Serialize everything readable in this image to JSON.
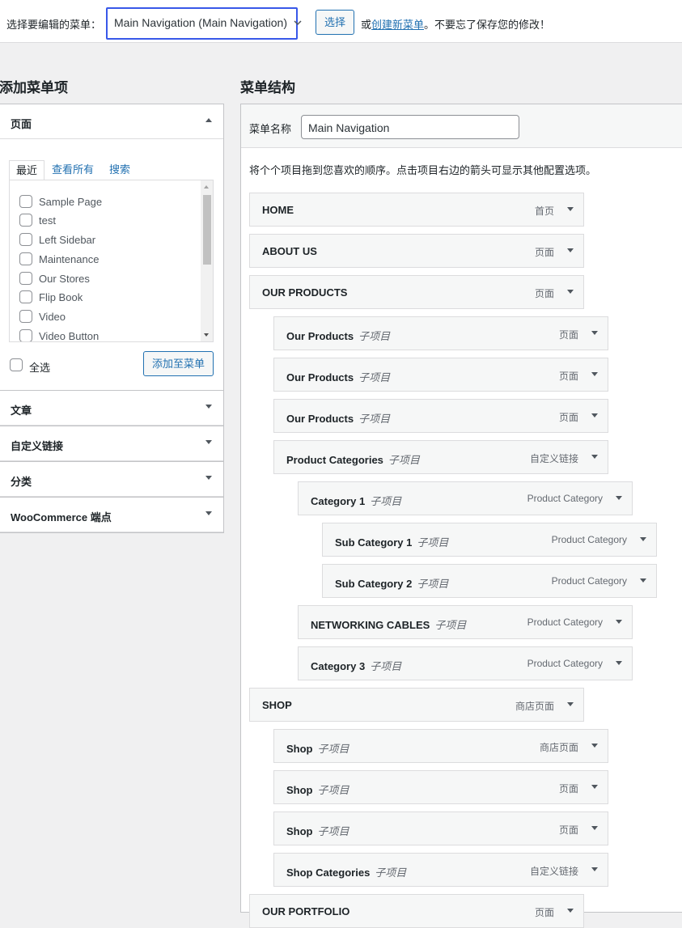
{
  "top_bar": {
    "select_label": "选择要编辑的菜单：",
    "selected_menu": "Main Navigation (Main Navigation)",
    "select_button": "选择",
    "hint_prefix": "或",
    "create_link": "创建新菜单",
    "hint_suffix": "。不要忘了保存您的修改！"
  },
  "add_items": {
    "heading": "添加菜单项",
    "pages_panel": {
      "title": "页面",
      "tabs": [
        "最近",
        "查看所有",
        "搜索"
      ],
      "items": [
        "Sample Page",
        "test",
        "Left Sidebar",
        "Maintenance",
        "Our Stores",
        "Flip Book",
        "Video",
        "Video Button"
      ],
      "select_all": "全选",
      "add_button": "添加至菜单"
    },
    "panels": [
      "文章",
      "自定义链接",
      "分类",
      "WooCommerce 端点"
    ]
  },
  "structure": {
    "heading": "菜单结构",
    "name_label": "菜单名称",
    "name_value": "Main Navigation",
    "instructions": "将个个项目拖到您喜欢的顺序。点击项目右边的箭头可显示其他配置选项。",
    "sub_label": "子项目",
    "items": [
      {
        "title": "HOME",
        "type": "首页",
        "depth": 0,
        "sub": false
      },
      {
        "title": "ABOUT US",
        "type": "页面",
        "depth": 0,
        "sub": false
      },
      {
        "title": "OUR PRODUCTS",
        "type": "页面",
        "depth": 0,
        "sub": false
      },
      {
        "title": "Our Products",
        "type": "页面",
        "depth": 1,
        "sub": true
      },
      {
        "title": "Our Products",
        "type": "页面",
        "depth": 1,
        "sub": true
      },
      {
        "title": "Our Products",
        "type": "页面",
        "depth": 1,
        "sub": true
      },
      {
        "title": "Product Categories",
        "type": "自定义链接",
        "depth": 1,
        "sub": true
      },
      {
        "title": "Category 1",
        "type": "Product Category",
        "depth": 2,
        "sub": true
      },
      {
        "title": "Sub Category 1",
        "type": "Product Category",
        "depth": 3,
        "sub": true
      },
      {
        "title": "Sub Category 2",
        "type": "Product Category",
        "depth": 3,
        "sub": true
      },
      {
        "title": "NETWORKING CABLES",
        "type": "Product Category",
        "depth": 2,
        "sub": true
      },
      {
        "title": "Category 3",
        "type": "Product Category",
        "depth": 2,
        "sub": true
      },
      {
        "title": "SHOP",
        "type": "商店页面",
        "depth": 0,
        "sub": false
      },
      {
        "title": "Shop",
        "type": "商店页面",
        "depth": 1,
        "sub": true
      },
      {
        "title": "Shop",
        "type": "页面",
        "depth": 1,
        "sub": true
      },
      {
        "title": "Shop",
        "type": "页面",
        "depth": 1,
        "sub": true
      },
      {
        "title": "Shop Categories",
        "type": "自定义链接",
        "depth": 1,
        "sub": true
      },
      {
        "title": "OUR PORTFOLIO",
        "type": "页面",
        "depth": 0,
        "sub": false
      }
    ]
  }
}
